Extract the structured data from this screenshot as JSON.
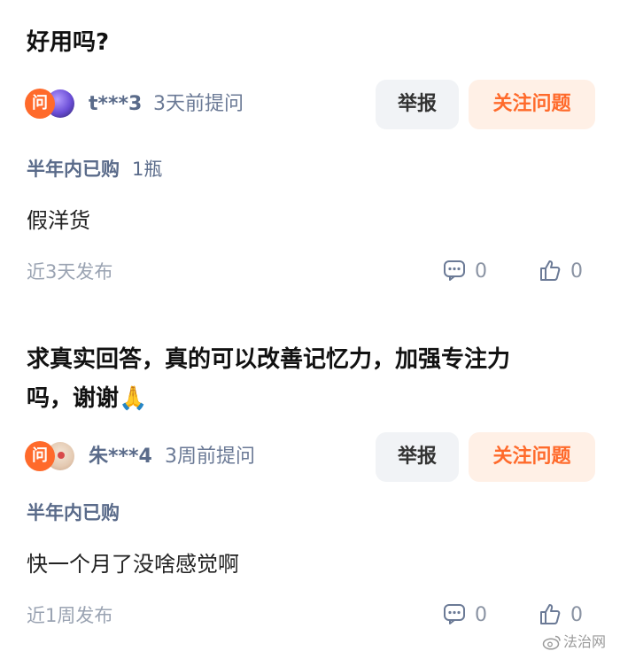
{
  "questions": [
    {
      "title": "好用吗?",
      "asker_name": "t***3",
      "ask_time": "3天前提问",
      "report_label": "举报",
      "follow_label": "关注问题",
      "question_badge": "问",
      "purchase_info": "半年内已购",
      "purchase_qty": "1瓶",
      "answer": "假洋货",
      "publish_time": "近3天发布",
      "comment_count": "0",
      "like_count": "0"
    },
    {
      "title_line1": "求真实回答，真的可以改善记忆力，加强专注力",
      "title_line2": "吗，谢谢🙏",
      "asker_name": "朱***4",
      "ask_time": "3周前提问",
      "report_label": "举报",
      "follow_label": "关注问题",
      "question_badge": "问",
      "purchase_info": "半年内已购",
      "answer": "快一个月了没啥感觉啊",
      "publish_time": "近1周发布",
      "comment_count": "0",
      "like_count": "0"
    }
  ],
  "watermark": "法治网",
  "icons": {
    "comment": "comment-icon",
    "like": "thumbs-up-icon",
    "watermark": "weibo-icon"
  },
  "colors": {
    "accent": "#ff6a2b",
    "follow_bg": "#fff0e6",
    "report_bg": "#f1f3f6",
    "muted": "#9aa3b2"
  }
}
